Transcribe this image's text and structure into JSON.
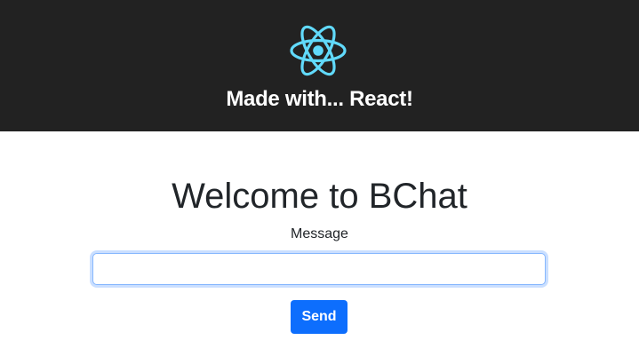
{
  "header": {
    "logo_icon": "react-atom-icon",
    "logo_color": "#61dafb",
    "background": "#222222",
    "title": "Made with... React!"
  },
  "main": {
    "title": "Welcome to BChat",
    "form": {
      "message_label": "Message",
      "message_value": "",
      "message_placeholder": "",
      "send_label": "Send",
      "accent_color": "#0d6efd"
    }
  }
}
